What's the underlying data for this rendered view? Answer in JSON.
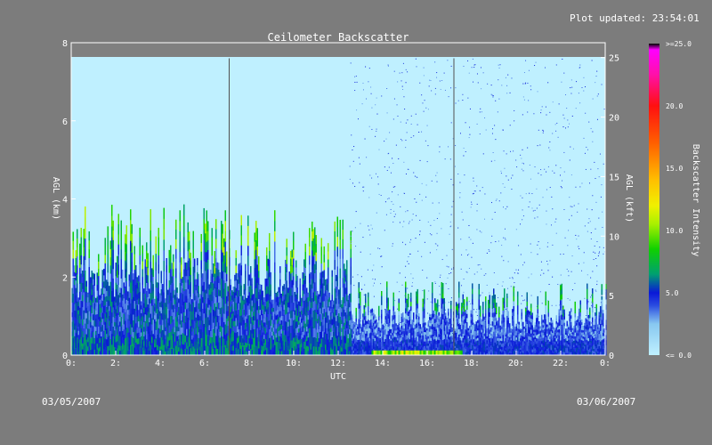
{
  "header": {
    "plot_updated": "Plot updated: 23:54:01"
  },
  "footer": {
    "start_date": "03/05/2007",
    "end_date": "03/06/2007"
  },
  "chart_data": {
    "type": "heatmap",
    "title": "Ceilometer Backscatter",
    "xlabel": "UTC",
    "ylabel_left": "AGL (km)",
    "ylabel_right": "AGL (kft)",
    "colorbar_label": "Backscatter Intensity",
    "xlim": [
      0,
      24
    ],
    "ylim_km": [
      0,
      8
    ],
    "ylim_kft": [
      0,
      26.25
    ],
    "data_top_km": 7.6,
    "x_ticks": [
      {
        "value": 0,
        "label": "0:"
      },
      {
        "value": 2,
        "label": "2:"
      },
      {
        "value": 4,
        "label": "4:"
      },
      {
        "value": 6,
        "label": "6:"
      },
      {
        "value": 8,
        "label": "8:"
      },
      {
        "value": 10,
        "label": "10:"
      },
      {
        "value": 12,
        "label": "12:"
      },
      {
        "value": 14,
        "label": "14:"
      },
      {
        "value": 16,
        "label": "16:"
      },
      {
        "value": 18,
        "label": "18:"
      },
      {
        "value": 20,
        "label": "20:"
      },
      {
        "value": 22,
        "label": "22:"
      },
      {
        "value": 24,
        "label": "0:"
      }
    ],
    "y_ticks_km": [
      {
        "value": 0,
        "label": "0"
      },
      {
        "value": 2,
        "label": "2"
      },
      {
        "value": 4,
        "label": "4"
      },
      {
        "value": 6,
        "label": "6"
      },
      {
        "value": 8,
        "label": "8"
      }
    ],
    "y_ticks_kft": [
      {
        "value": 0,
        "label": "0"
      },
      {
        "value": 5,
        "label": "5"
      },
      {
        "value": 10,
        "label": "10"
      },
      {
        "value": 15,
        "label": "15"
      },
      {
        "value": 20,
        "label": "20"
      },
      {
        "value": 25,
        "label": "25"
      }
    ],
    "vertical_lines_utc": [
      7.1,
      17.2
    ],
    "colorbar": {
      "min": 0,
      "max": 25,
      "ticks": [
        {
          "value": 0,
          "label": "<= 0.0"
        },
        {
          "value": 5,
          "label": "5.0"
        },
        {
          "value": 10,
          "label": "10.0"
        },
        {
          "value": 15,
          "label": "15.0"
        },
        {
          "value": 20,
          "label": "20.0"
        },
        {
          "value": 25,
          "label": ">=25.0"
        }
      ],
      "stops": [
        {
          "value": 0,
          "color": "#bff0ff"
        },
        {
          "value": 2.5,
          "color": "#88c8f0"
        },
        {
          "value": 4,
          "color": "#2a4be0"
        },
        {
          "value": 5,
          "color": "#0a18d8"
        },
        {
          "value": 6.5,
          "color": "#00a070"
        },
        {
          "value": 8.5,
          "color": "#10d000"
        },
        {
          "value": 10.5,
          "color": "#a8f000"
        },
        {
          "value": 12,
          "color": "#f0f000"
        },
        {
          "value": 14,
          "color": "#ffc000"
        },
        {
          "value": 17,
          "color": "#ff6000"
        },
        {
          "value": 20,
          "color": "#ff1010"
        },
        {
          "value": 22.5,
          "color": "#ff10a8"
        },
        {
          "value": 24.5,
          "color": "#ff00ff"
        },
        {
          "value": 25,
          "color": "#000000"
        }
      ]
    },
    "bands": [
      {
        "from_utc": 0,
        "to_utc": 12.6,
        "low_layer_top_km": 0.4,
        "aerosol_top_km": 2.5,
        "plume_top_km": 3.9,
        "intensity": 5
      },
      {
        "from_utc": 12.6,
        "to_utc": 24,
        "low_layer_top_km": 0.35,
        "aerosol_top_km": 1.2,
        "plume_top_km": 1.9,
        "intensity": 4
      }
    ],
    "surface_layer": {
      "from_utc": 13.5,
      "to_utc": 17.5,
      "top_km": 0.12,
      "intensity": 11
    }
  }
}
